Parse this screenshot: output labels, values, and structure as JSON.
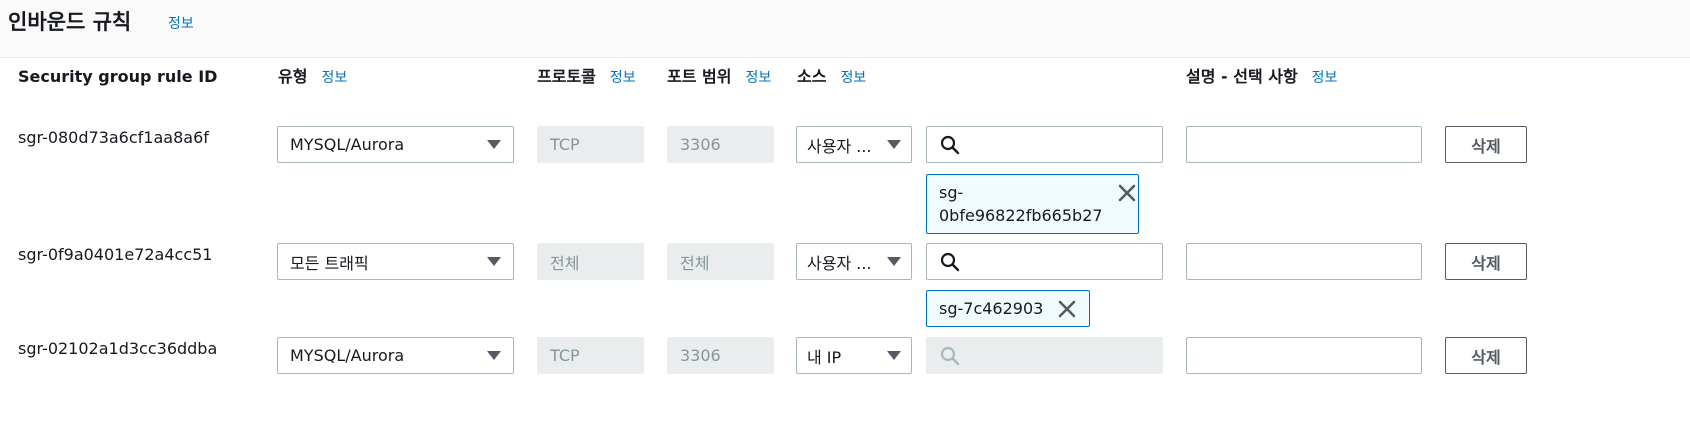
{
  "header": {
    "title": "인바운드 규칙",
    "info": "정보"
  },
  "columns": {
    "rule_id": "Security group rule ID",
    "type": "유형",
    "type_info": "정보",
    "protocol": "프로토콜",
    "protocol_info": "정보",
    "port_range": "포트 범위",
    "port_info": "정보",
    "source": "소스",
    "source_info": "정보",
    "description": "설명 - 선택 사항",
    "description_info": "정보"
  },
  "rules": [
    {
      "id": "sgr-080d73a6cf1aa8a6f",
      "type": "MYSQL/Aurora",
      "protocol": "TCP",
      "port": "3306",
      "source_type": "사용자 ...",
      "search_value": "",
      "chip": "sg-0bfe96822fb665b27",
      "description": "",
      "delete_label": "삭제"
    },
    {
      "id": "sgr-0f9a0401e72a4cc51",
      "type": "모든 트래픽",
      "protocol": "전체",
      "port": "전체",
      "source_type": "사용자 ...",
      "search_value": "",
      "chip": "sg-7c462903",
      "description": "",
      "delete_label": "삭제"
    },
    {
      "id": "sgr-02102a1d3cc36ddba",
      "type": "MYSQL/Aurora",
      "protocol": "TCP",
      "port": "3306",
      "source_type": "내 IP",
      "search_value": "",
      "description": "",
      "delete_label": "삭제"
    }
  ],
  "icons": {
    "search": "search-icon",
    "remove": "close-icon",
    "dropdown": "caret-down-icon"
  },
  "colors": {
    "link": "#0073bb",
    "chip_border": "#0073bb",
    "disabled_bg": "#eaeded"
  }
}
